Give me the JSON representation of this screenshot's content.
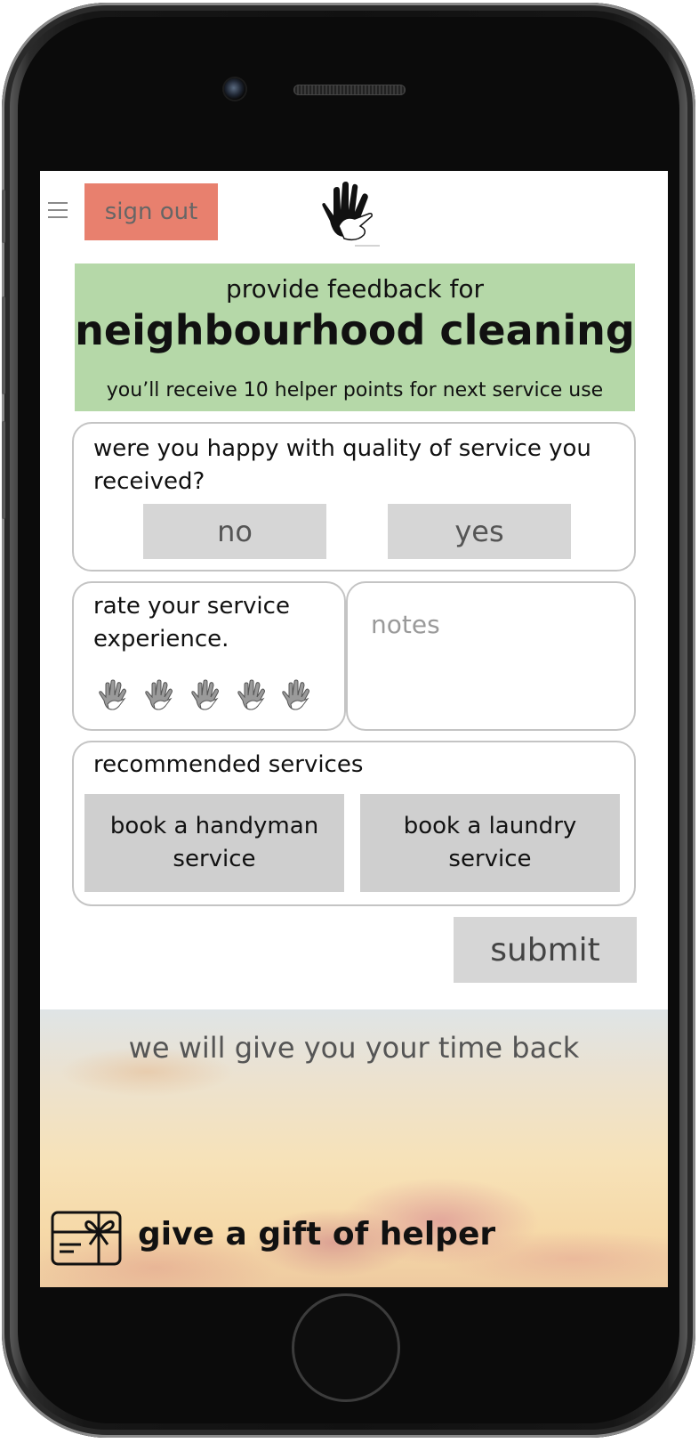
{
  "header": {
    "menu_icon": "hamburger-icon",
    "signout_label": "sign out",
    "logo_icon": "hand-logo-icon"
  },
  "banner": {
    "subtitle": "provide feedback for",
    "title": "neighbourhood cleaning",
    "points_text": "you’ll receive 10 helper points for next service use",
    "color": "#b5d8a8"
  },
  "quality": {
    "question": "were you happy with quality of service you received?",
    "no_label": "no",
    "yes_label": "yes"
  },
  "rating": {
    "prompt": "rate your service experience.",
    "icon": "hand-rating-icon",
    "max": 5
  },
  "notes": {
    "placeholder": "notes"
  },
  "recommended": {
    "title": "recommended services",
    "handyman_label": "book a handyman service",
    "laundry_label": "book a laundry service"
  },
  "submit_label": "submit",
  "footer": {
    "tagline": "we will give you your time back",
    "gift_icon": "gift-card-icon",
    "gift_label": "give a gift of helper"
  },
  "colors": {
    "signout_bg": "#e8806e",
    "button_grey": "#d6d6d6"
  }
}
